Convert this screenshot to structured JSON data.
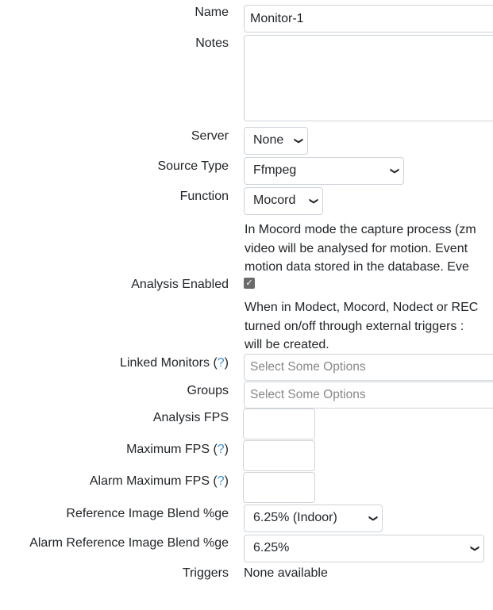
{
  "fields": {
    "name": {
      "label": "Name",
      "value": "Monitor-1"
    },
    "notes": {
      "label": "Notes",
      "value": ""
    },
    "server": {
      "label": "Server",
      "selected": "None"
    },
    "source_type": {
      "label": "Source Type",
      "selected": "Ffmpeg"
    },
    "function": {
      "label": "Function",
      "selected": "Mocord",
      "help_lines": [
        "In Mocord mode the capture process (zm",
        "video will be analysed for motion. Event",
        "motion data stored in the database. Eve"
      ]
    },
    "analysis_enabled": {
      "label": "Analysis Enabled",
      "checked": true,
      "help_lines": [
        "When in Modect, Mocord, Nodect or REC",
        "turned on/off through external triggers :",
        "will be created."
      ]
    },
    "linked_monitors": {
      "label": "Linked Monitors (",
      "help": "?",
      "close": ")",
      "placeholder": "Select Some Options"
    },
    "groups": {
      "label": "Groups",
      "placeholder": "Select Some Options"
    },
    "analysis_fps": {
      "label": "Analysis FPS",
      "value": ""
    },
    "maximum_fps": {
      "label": "Maximum FPS (",
      "help": "?",
      "close": ")",
      "value": ""
    },
    "alarm_maximum_fps": {
      "label": "Alarm Maximum FPS (",
      "help": "?",
      "close": ")",
      "value": ""
    },
    "ref_blend": {
      "label": "Reference Image Blend %ge",
      "selected": "6.25% (Indoor)"
    },
    "alarm_ref_blend": {
      "label": "Alarm Reference Image Blend %ge",
      "selected": "6.25%"
    },
    "triggers": {
      "label": "Triggers",
      "value": "None available"
    }
  },
  "icons": {
    "select_caret": "chevron-down-icon",
    "checkbox": "checkmark-icon"
  },
  "colors": {
    "help_link": "#3b8fd6",
    "border": "#ced4da",
    "checkbox": "#6b6b6b"
  }
}
